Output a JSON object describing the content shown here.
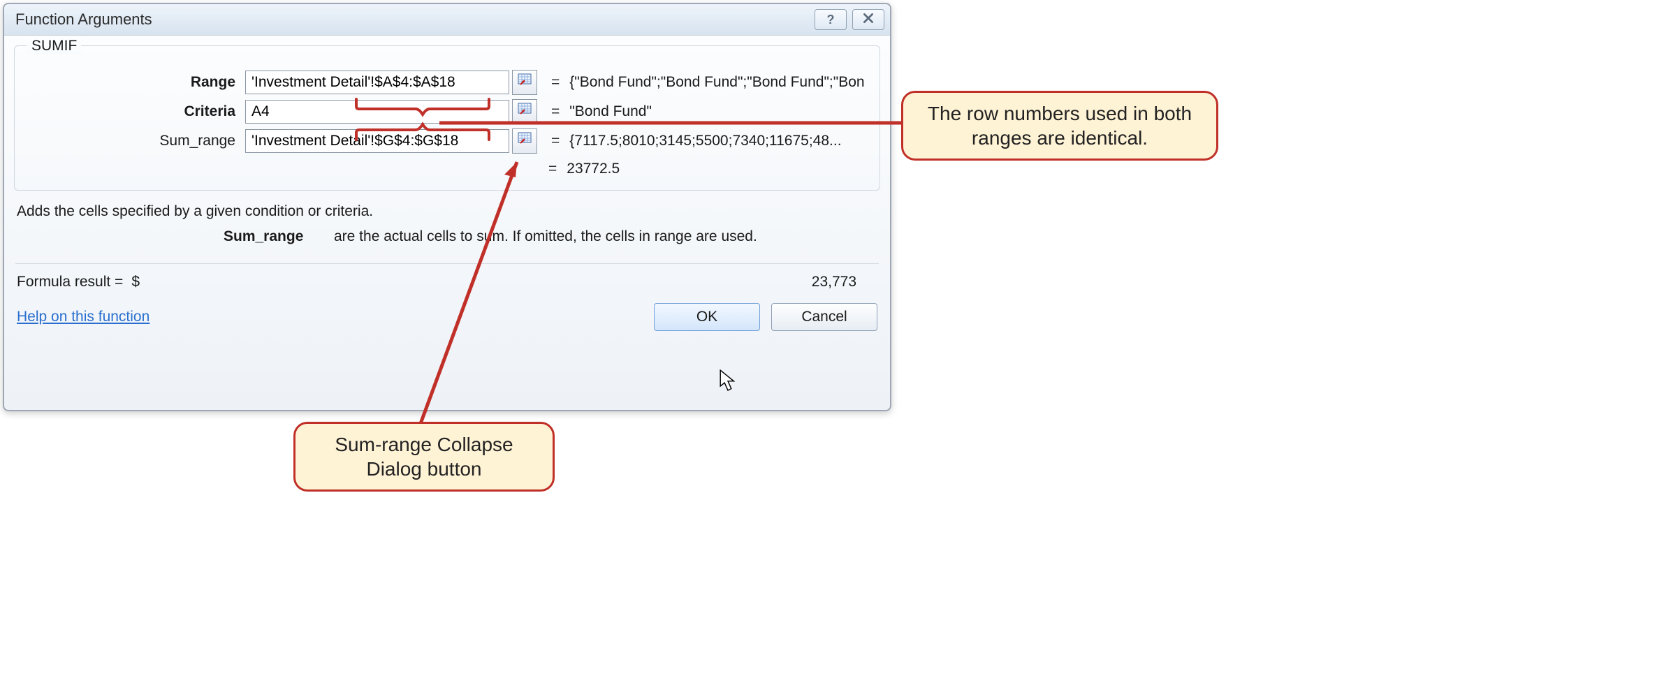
{
  "dialog": {
    "title": "Function Arguments",
    "function_name": "SUMIF",
    "args": [
      {
        "label": "Range",
        "bold": true,
        "value": "'Investment Detail'!$A$4:$A$18",
        "result": "{\"Bond Fund\";\"Bond Fund\";\"Bond Fund\";\"Bon"
      },
      {
        "label": "Criteria",
        "bold": true,
        "value": "A4",
        "result": "\"Bond Fund\""
      },
      {
        "label": "Sum_range",
        "bold": false,
        "value": "'Investment Detail'!$G$4:$G$18",
        "result": "{7117.5;8010;3145;5500;7340;11675;48..."
      }
    ],
    "overall_result": "23772.5",
    "description": "Adds the cells specified by a given condition or criteria.",
    "arg_detail": {
      "name": "Sum_range",
      "text": "are the actual cells to sum. If omitted, the cells in range are used."
    },
    "formula_result_label": "Formula result =",
    "formula_result_currency": "$",
    "formula_result_value": "23,773",
    "help_link": "Help on this function",
    "ok_label": "OK",
    "cancel_label": "Cancel"
  },
  "callouts": {
    "right": "The row numbers used in both ranges are identical.",
    "bottom": "Sum-range Collapse Dialog button"
  }
}
